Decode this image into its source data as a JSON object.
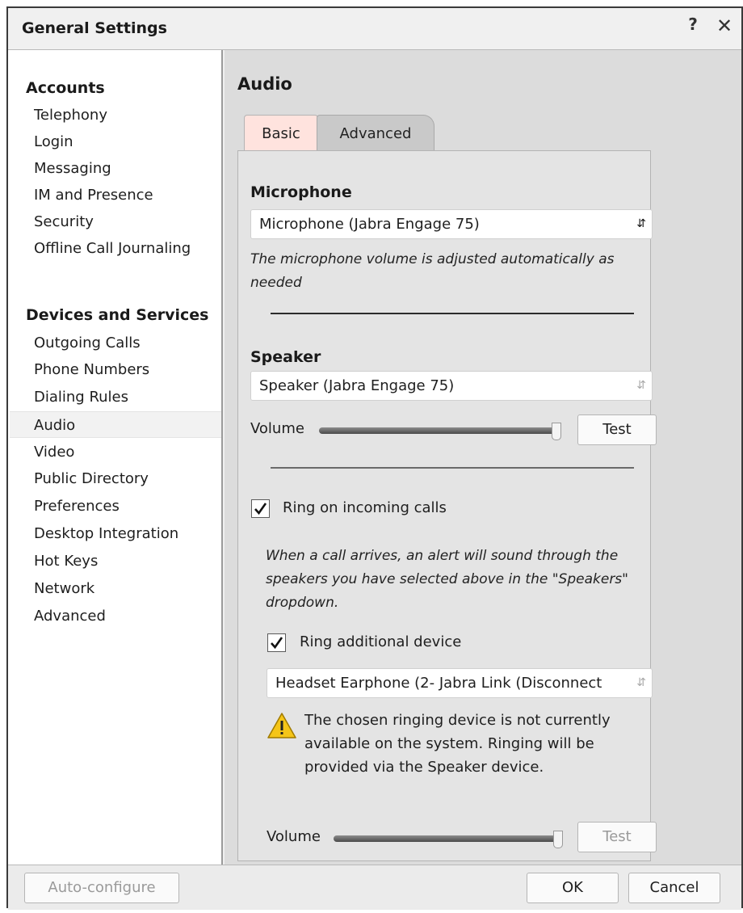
{
  "window": {
    "title": "General Settings",
    "help_label": "?",
    "close_label": "✕"
  },
  "sidebar": {
    "sections": [
      {
        "header": "Accounts",
        "items": [
          "Telephony",
          "Login",
          "Messaging",
          "IM and Presence",
          "Security",
          "Offline Call Journaling"
        ]
      },
      {
        "header": "Devices and Services",
        "items": [
          "Outgoing Calls",
          "Phone Numbers",
          "Dialing Rules",
          "Audio",
          "Video",
          "Public Directory",
          "Preferences",
          "Desktop Integration",
          "Hot Keys",
          "Network",
          "Advanced"
        ]
      }
    ],
    "selected_item": "Audio"
  },
  "content": {
    "title": "Audio",
    "tabs": [
      {
        "label": "Basic",
        "active": false
      },
      {
        "label": "Advanced",
        "active": true
      }
    ],
    "microphone": {
      "heading": "Microphone",
      "device": "Microphone (Jabra Engage 75)",
      "note": "The microphone volume is adjusted automatically as needed"
    },
    "speaker": {
      "heading": "Speaker",
      "device": "Speaker (Jabra Engage 75)",
      "volume_label": "Volume",
      "volume_level": 0.98,
      "test_label": "Test"
    },
    "ring": {
      "label": "Ring on incoming calls",
      "checked": true,
      "note": "When a call arrives, an alert will sound through the speakers you have selected above in the \"Speakers\" dropdown.",
      "additional_label": "Ring additional device",
      "additional_checked": true,
      "additional_device": "Headset Earphone (2- Jabra Link (Disconnect",
      "warning": "The chosen ringing device is not currently available on the system. Ringing will be provided via the Speaker device.",
      "volume_label": "Volume",
      "volume_level": 0.98,
      "test_label": "Test"
    }
  },
  "footer": {
    "auto_configure_label": "Auto-configure",
    "ok_label": "OK",
    "cancel_label": "Cancel"
  },
  "icons": {
    "warning": "warning-icon",
    "checkmark": "checkmark-icon",
    "help": "help-icon",
    "close": "close-icon",
    "select_arrow": "updown-arrow-icon"
  },
  "colors": {
    "tab_basic_bg": "#ffe3de",
    "tab_advanced_bg": "#c9c9c9",
    "content_bg": "#dcdcdc",
    "warning_yellow": "#f5c518"
  }
}
